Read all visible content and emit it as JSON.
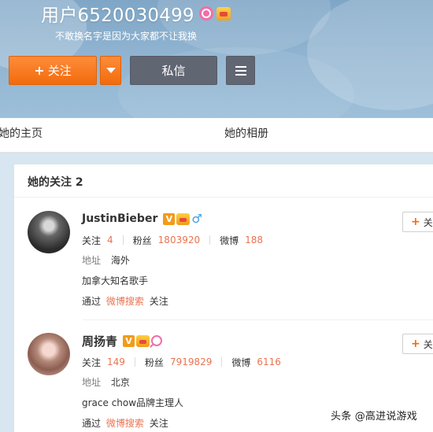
{
  "profile": {
    "username": "用户6520030499",
    "bio": "不敢换名字是因为大家都不让我换"
  },
  "actions": {
    "follow_label": "关注",
    "message_label": "私信"
  },
  "tabs": [
    {
      "label": "她的主页"
    },
    {
      "label": "她的相册"
    }
  ],
  "following": {
    "title": "她的关注 2",
    "items": [
      {
        "name": "JustinBieber",
        "stats": [
          {
            "label": "关注",
            "value": "4"
          },
          {
            "label": "粉丝",
            "value": "1803920"
          },
          {
            "label": "微博",
            "value": "188"
          }
        ],
        "address_label": "地址",
        "address": "海外",
        "description": "加拿大知名歌手",
        "via_prefix": "通过",
        "via_link": "微博搜索",
        "via_suffix": "关注",
        "follow_button": "关"
      },
      {
        "name": "周扬青",
        "stats": [
          {
            "label": "关注",
            "value": "149"
          },
          {
            "label": "粉丝",
            "value": "7919829"
          },
          {
            "label": "微博",
            "value": "6116"
          }
        ],
        "address_label": "地址",
        "address": "北京",
        "description": "grace chow品牌主理人",
        "via_prefix": "通过",
        "via_link": "微博搜索",
        "via_suffix": "关注",
        "follow_button": "关"
      }
    ]
  },
  "watermark": "头条 @高进说游戏",
  "colors": {
    "accent_orange": "#f26b0c",
    "link_orange": "#eb7350",
    "dark_button": "#616673",
    "verified_badge": "#f29b1a",
    "male_blue": "#3c9be0",
    "pink_badge": "#f06fa8"
  },
  "icons": {
    "verified": "V",
    "male": "♂"
  }
}
